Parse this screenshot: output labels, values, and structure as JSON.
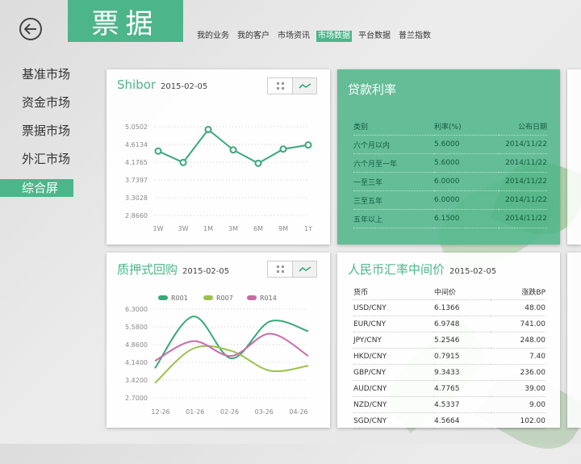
{
  "header": {
    "title": "票据"
  },
  "topnav": {
    "items": [
      "我的业务",
      "我的客户",
      "市场资讯",
      "市场数据",
      "平台数据",
      "普兰指数"
    ],
    "active": "市场数据"
  },
  "sidenav": {
    "items": [
      "基准市场",
      "资金市场",
      "票据市场",
      "外汇市场",
      "综合屏"
    ],
    "active": "综合屏"
  },
  "colors": {
    "accent": "#4db58a",
    "teal": "#3aa77a",
    "olive": "#99c24d",
    "pink": "#c86ca6",
    "up": "#d9363e",
    "down": "#3aa774"
  },
  "shibor": {
    "title": "Shibor",
    "date": "2015-02-05",
    "chart_data": {
      "type": "line",
      "categories": [
        "1W",
        "3W",
        "1M",
        "3M",
        "6M",
        "9M",
        "1Y"
      ],
      "values": [
        4.45,
        4.17,
        4.98,
        4.48,
        4.15,
        4.5,
        4.6
      ],
      "yticks": [
        "5.0502",
        "4.6134",
        "4.1765",
        "3.7397",
        "3.3028",
        "2.8660"
      ],
      "ylim": [
        2.866,
        5.0502
      ]
    }
  },
  "loan": {
    "title": "贷款利率",
    "headers": [
      "类别",
      "利率(%)",
      "公布日期"
    ],
    "rows": [
      [
        "六个月以内",
        "5.6000",
        "2014/11/22"
      ],
      [
        "六个月至一年",
        "5.6000",
        "2014/11/22"
      ],
      [
        "一至三年",
        "6.0000",
        "2014/11/22"
      ],
      [
        "三至五年",
        "6.0000",
        "2014/11/22"
      ],
      [
        "五年以上",
        "6.1500",
        "2014/11/22"
      ]
    ]
  },
  "repo": {
    "title": "质押式回购",
    "date": "2015-02-05",
    "chart_data": {
      "type": "line",
      "categories": [
        "12-26",
        "01-26",
        "02-26",
        "03-26",
        "04-26"
      ],
      "series": [
        {
          "name": "R001",
          "values": [
            3.9,
            6.0,
            4.3,
            5.8,
            5.4
          ]
        },
        {
          "name": "R007",
          "values": [
            3.3,
            4.7,
            4.6,
            3.8,
            4.0
          ]
        },
        {
          "name": "R014",
          "values": [
            4.2,
            5.0,
            4.4,
            5.3,
            4.4
          ]
        }
      ],
      "yticks": [
        "6.3000",
        "5.5800",
        "4.8600",
        "4.1400",
        "3.4200",
        "2.7000"
      ],
      "ylim": [
        2.7,
        6.3
      ]
    }
  },
  "fx": {
    "title": "人民币汇率中间价",
    "date": "2015-02-05",
    "headers": [
      "货币",
      "中间价",
      "涨跌BP"
    ],
    "rows": [
      {
        "pair": "USD/CNY",
        "price": "6.1366",
        "change": "48.00",
        "dir": "up"
      },
      {
        "pair": "EUR/CNY",
        "price": "6.9748",
        "change": "741.00",
        "dir": "down"
      },
      {
        "pair": "JPY/CNY",
        "price": "5.2546",
        "change": "248.00",
        "dir": "down"
      },
      {
        "pair": "HKD/CNY",
        "price": "0.7915",
        "change": "7.40",
        "dir": "down"
      },
      {
        "pair": "GBP/CNY",
        "price": "9.3433",
        "change": "236.00",
        "dir": "down"
      },
      {
        "pair": "AUD/CNY",
        "price": "4.7765",
        "change": "39.00",
        "dir": "down"
      },
      {
        "pair": "NZD/CNY",
        "price": "4.5337",
        "change": "9.00",
        "dir": "down"
      },
      {
        "pair": "SGD/CNY",
        "price": "4.5664",
        "change": "102.00",
        "dir": "up"
      }
    ]
  }
}
